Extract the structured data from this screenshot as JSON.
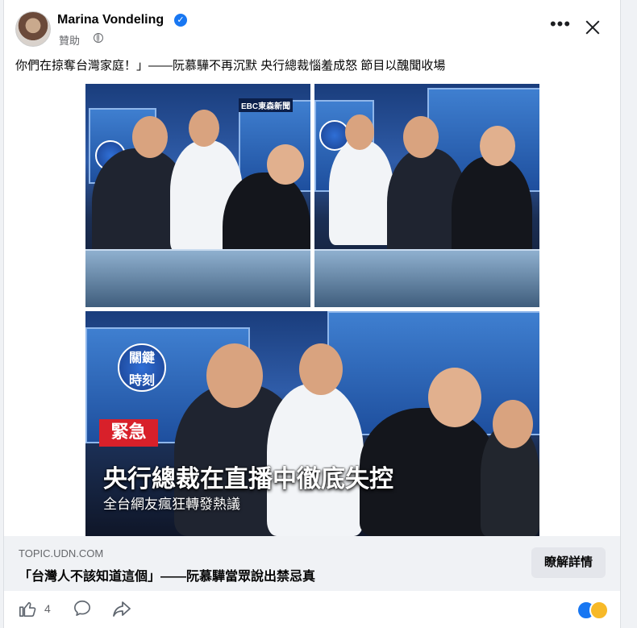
{
  "post": {
    "author": "Marina Vondeling",
    "sponsored_label": "贊助",
    "text": "你們在掠奪台灣家庭！」——阮慕驊不再沉默 央行總裁惱羞成怒 節目以醜聞收場"
  },
  "media": {
    "ebc_label": "EBC東森新聞",
    "show_logo_top": "關鍵",
    "show_logo_bottom": "時刻",
    "urgent_label": "緊急",
    "headline": "央行總裁在直播中徹底失控",
    "subline": "全台網友瘋狂轉發熱議"
  },
  "link": {
    "domain": "TOPIC.UDN.COM",
    "title": "「台灣人不該知道這個」——阮慕驊當眾說出禁忌真",
    "button_label": "瞭解詳情"
  },
  "footer": {
    "like_count": "4"
  },
  "icons": {
    "verified": "verified-badge-icon",
    "globe": "globe-icon",
    "more": "more-options-icon",
    "close": "close-icon",
    "like": "like-icon",
    "comment": "comment-icon",
    "share": "share-icon"
  },
  "colors": {
    "accent": "#1877f2",
    "urgent": "#d8202a",
    "wow": "#f7b928"
  }
}
